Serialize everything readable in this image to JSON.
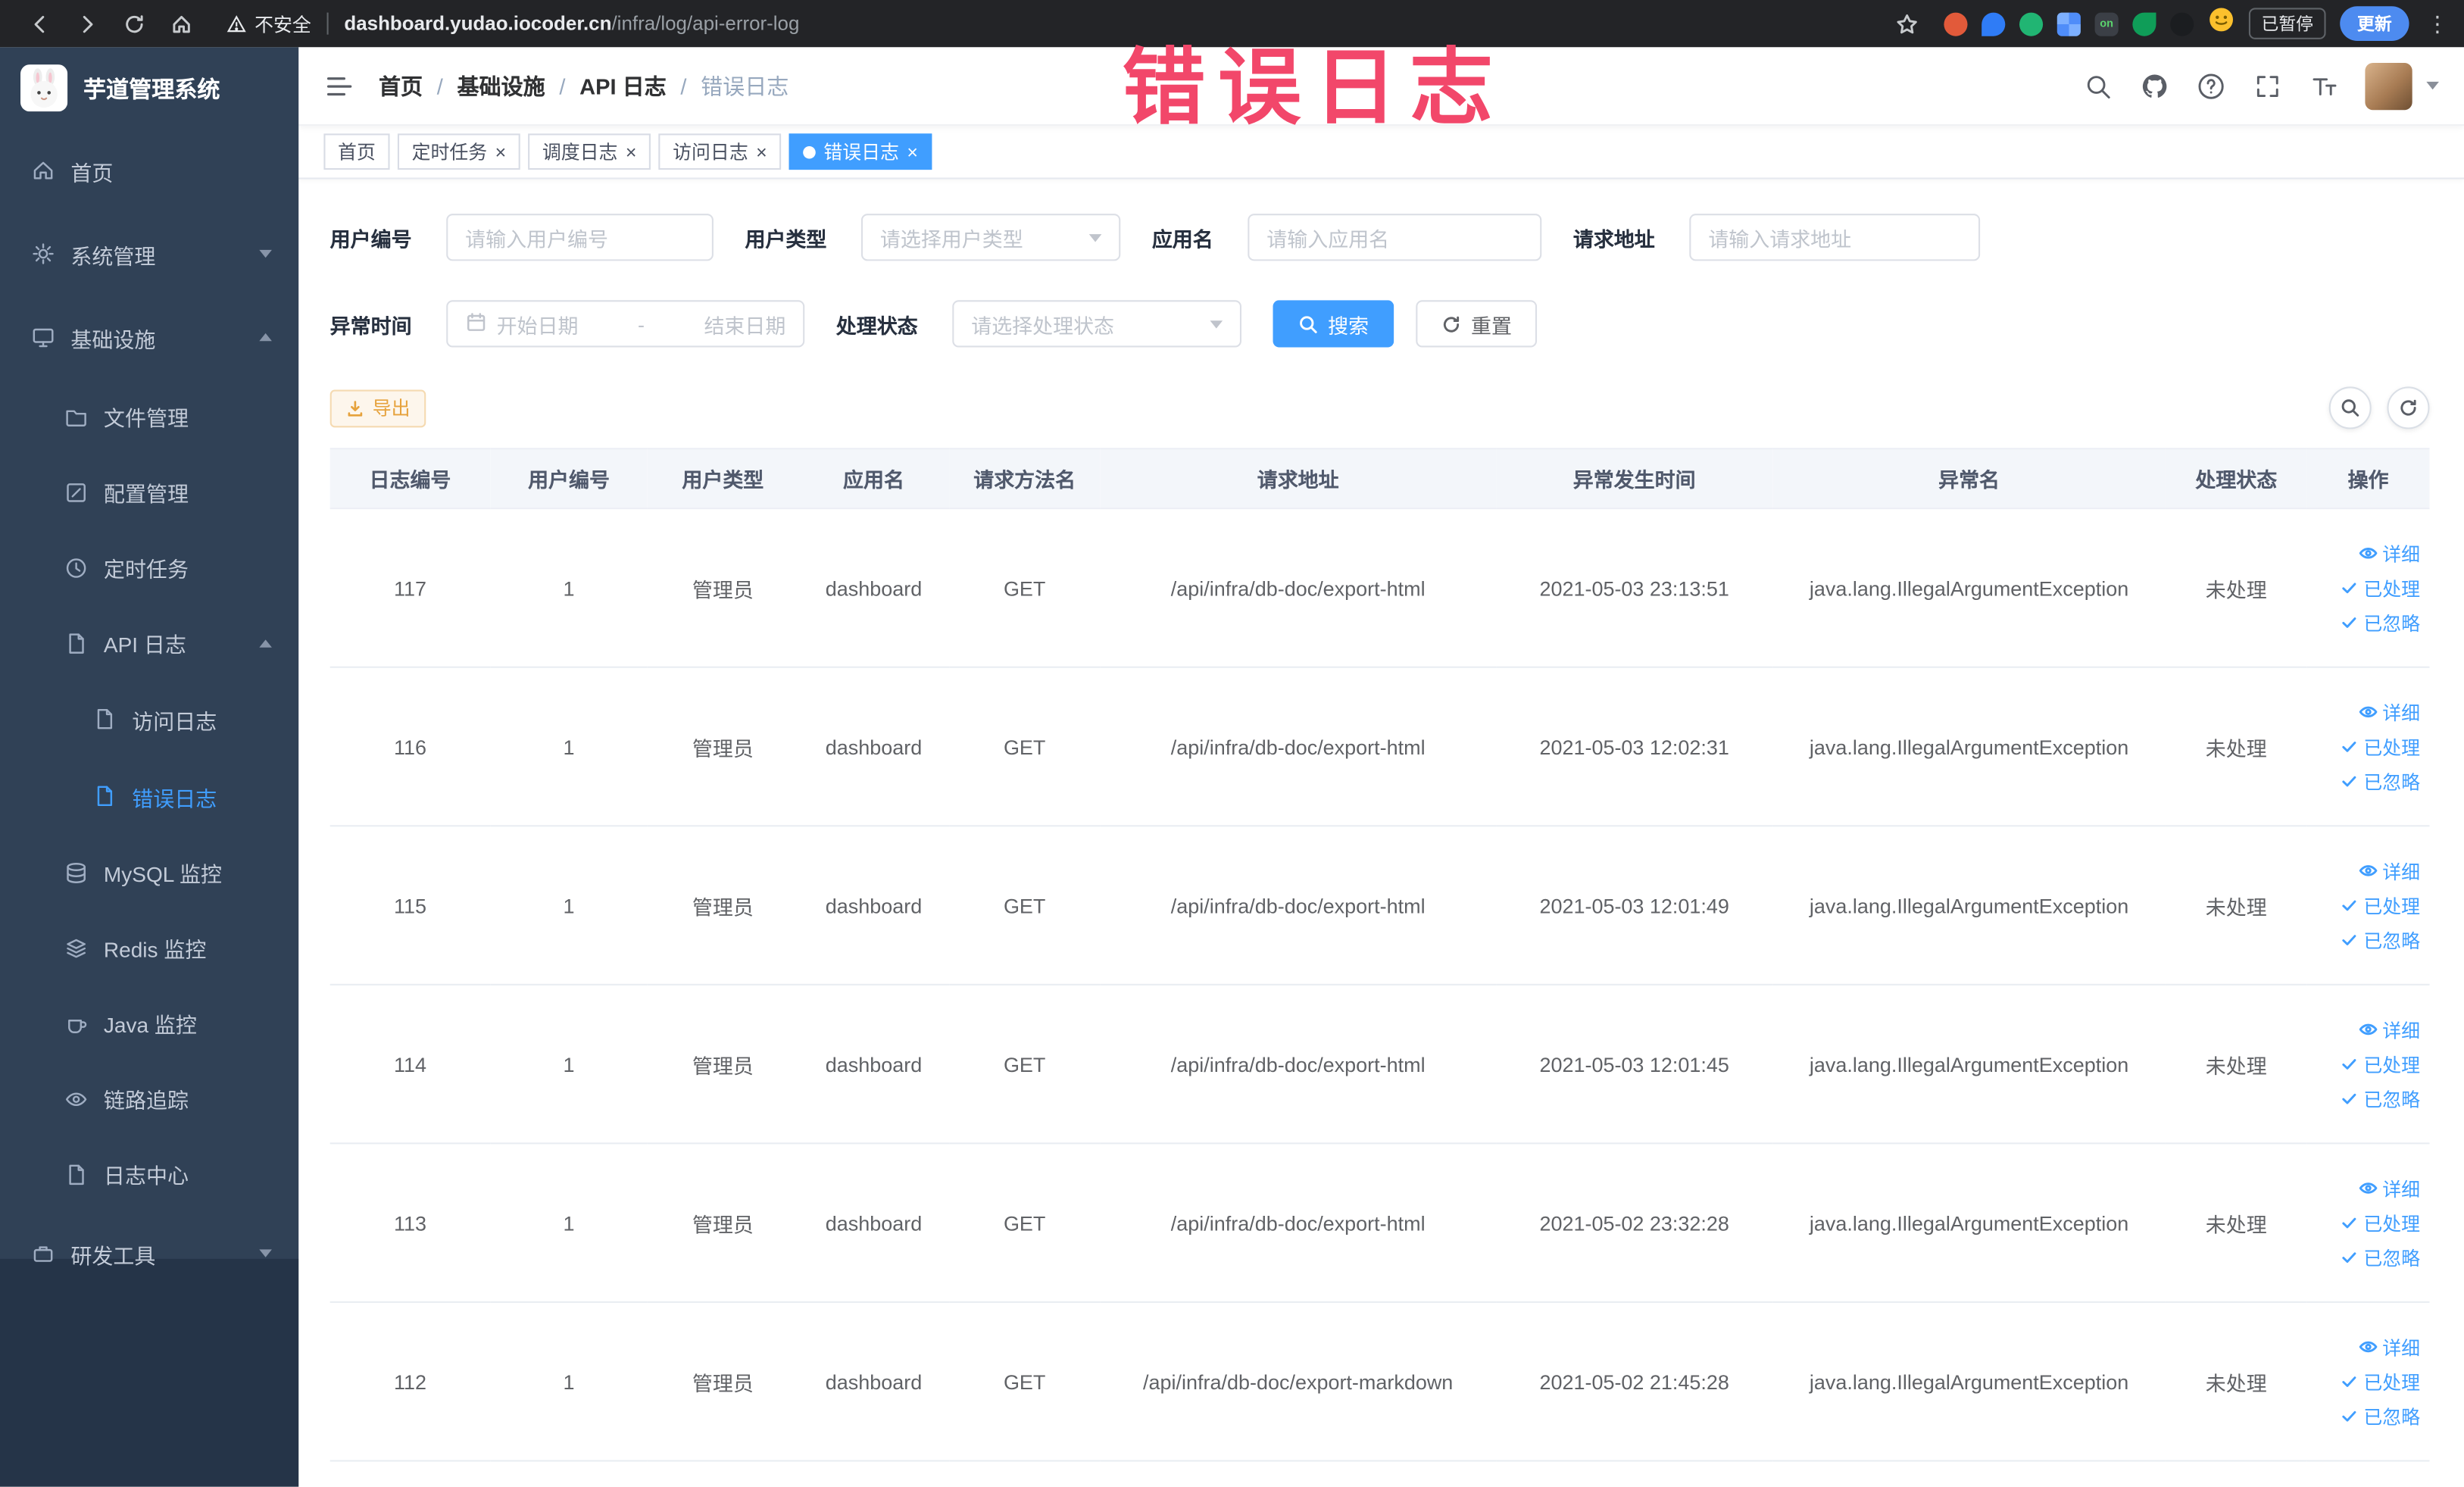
{
  "ui": {
    "slash": "/",
    "close": "×",
    "dash": "-",
    "kebab": "⋮"
  },
  "colors": {
    "accent": "#409EFF",
    "warning": "#E6A23C",
    "sidebar_bg": "#304156",
    "annotation": "#F2476A"
  },
  "browser": {
    "security_label": "不安全",
    "url_domain": "dashboard.yudao.iocoder.cn",
    "url_path": "/infra/log/api-error-log",
    "ext_on_badge": "on",
    "paused_badge": "已暂停",
    "update_button": "更新"
  },
  "annotation": {
    "text": "错误日志"
  },
  "sidebar": {
    "logo_title": "芋道管理系统",
    "items": [
      {
        "label": "首页"
      },
      {
        "label": "系统管理"
      },
      {
        "label": "基础设施"
      },
      {
        "label": "文件管理"
      },
      {
        "label": "配置管理"
      },
      {
        "label": "定时任务"
      },
      {
        "label": "API 日志"
      },
      {
        "label": "访问日志"
      },
      {
        "label": "错误日志"
      },
      {
        "label": "MySQL 监控"
      },
      {
        "label": "Redis 监控"
      },
      {
        "label": "Java 监控"
      },
      {
        "label": "链路追踪"
      },
      {
        "label": "日志中心"
      },
      {
        "label": "研发工具"
      }
    ]
  },
  "navbar": {
    "breadcrumbs": [
      "首页",
      "基础设施",
      "API 日志",
      "错误日志"
    ]
  },
  "tags": [
    {
      "label": "首页"
    },
    {
      "label": "定时任务"
    },
    {
      "label": "调度日志"
    },
    {
      "label": "访问日志"
    },
    {
      "label": "错误日志"
    }
  ],
  "filters": {
    "user_id_label": "用户编号",
    "user_id_placeholder": "请输入用户编号",
    "user_type_label": "用户类型",
    "user_type_placeholder": "请选择用户类型",
    "app_name_label": "应用名",
    "app_name_placeholder": "请输入应用名",
    "request_url_label": "请求地址",
    "request_url_placeholder": "请输入请求地址",
    "exception_time_label": "异常时间",
    "date_start_placeholder": "开始日期",
    "date_separator": "-",
    "date_end_placeholder": "结束日期",
    "process_status_label": "处理状态",
    "process_status_placeholder": "请选择处理状态",
    "search_button": "搜索",
    "reset_button": "重置"
  },
  "toolbar": {
    "export_button": "导出"
  },
  "table": {
    "headers": [
      "日志编号",
      "用户编号",
      "用户类型",
      "应用名",
      "请求方法名",
      "请求地址",
      "异常发生时间",
      "异常名",
      "处理状态",
      "操作"
    ],
    "action_detail": "详细",
    "action_processed": "已处理",
    "action_ignored": "已忽略",
    "rows": [
      {
        "id": "117",
        "user_id": "1",
        "user_type": "管理员",
        "app": "dashboard",
        "method": "GET",
        "url": "/api/infra/db-doc/export-html",
        "time": "2021-05-03 23:13:51",
        "exception": "java.lang.IllegalArgumentException",
        "status": "未处理"
      },
      {
        "id": "116",
        "user_id": "1",
        "user_type": "管理员",
        "app": "dashboard",
        "method": "GET",
        "url": "/api/infra/db-doc/export-html",
        "time": "2021-05-03 12:02:31",
        "exception": "java.lang.IllegalArgumentException",
        "status": "未处理"
      },
      {
        "id": "115",
        "user_id": "1",
        "user_type": "管理员",
        "app": "dashboard",
        "method": "GET",
        "url": "/api/infra/db-doc/export-html",
        "time": "2021-05-03 12:01:49",
        "exception": "java.lang.IllegalArgumentException",
        "status": "未处理"
      },
      {
        "id": "114",
        "user_id": "1",
        "user_type": "管理员",
        "app": "dashboard",
        "method": "GET",
        "url": "/api/infra/db-doc/export-html",
        "time": "2021-05-03 12:01:45",
        "exception": "java.lang.IllegalArgumentException",
        "status": "未处理"
      },
      {
        "id": "113",
        "user_id": "1",
        "user_type": "管理员",
        "app": "dashboard",
        "method": "GET",
        "url": "/api/infra/db-doc/export-html",
        "time": "2021-05-02 23:32:28",
        "exception": "java.lang.IllegalArgumentException",
        "status": "未处理"
      },
      {
        "id": "112",
        "user_id": "1",
        "user_type": "管理员",
        "app": "dashboard",
        "method": "GET",
        "url": "/api/infra/db-doc/export-markdown",
        "time": "2021-05-02 21:45:28",
        "exception": "java.lang.IllegalArgumentException",
        "status": "未处理"
      }
    ]
  }
}
